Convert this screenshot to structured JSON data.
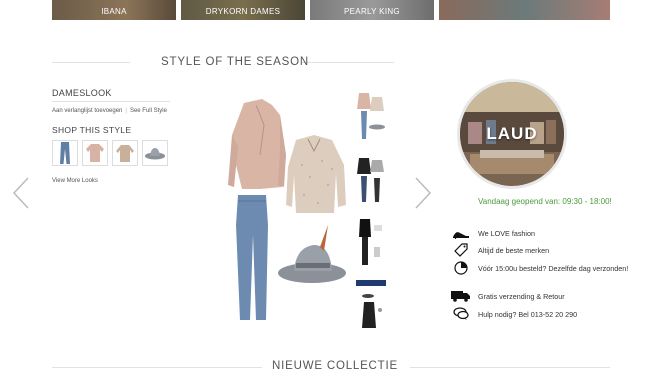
{
  "brand_tiles": [
    {
      "label": "IBANA"
    },
    {
      "label": "DRYKORN DAMES"
    },
    {
      "label": "PEARLY KING"
    },
    {
      "label": ""
    }
  ],
  "style_section": {
    "heading": "STYLE OF THE SEASON",
    "look_title": "DAMESLOOK",
    "add_wishlist": "Aan verlanglijst toevoegen",
    "see_full_style": "See Full Style",
    "shop_title": "SHOP THIS STYLE",
    "view_more": "View More Looks"
  },
  "store": {
    "logo_text": "LAUD",
    "opening_hours": "Vandaag geopend van: 09:30 - 18:00!",
    "features": [
      {
        "icon": "heel-icon",
        "text": "We LOVE fashion"
      },
      {
        "icon": "tag-icon",
        "text": "Altijd de beste merken"
      },
      {
        "icon": "clock-icon",
        "text": "Vóór 15:00u besteld? Dezelfde dag verzonden!"
      },
      {
        "icon": "truck-icon",
        "text": "Gratis verzending & Retour"
      },
      {
        "icon": "chat-icon",
        "text": "Hulp nodig? Bel 013-52 20 290"
      }
    ]
  },
  "new_collection": {
    "heading": "NIEUWE COLLECTIE"
  },
  "colors": {
    "accent_green": "#4a9a3a",
    "divider": "#e2e2e2"
  }
}
